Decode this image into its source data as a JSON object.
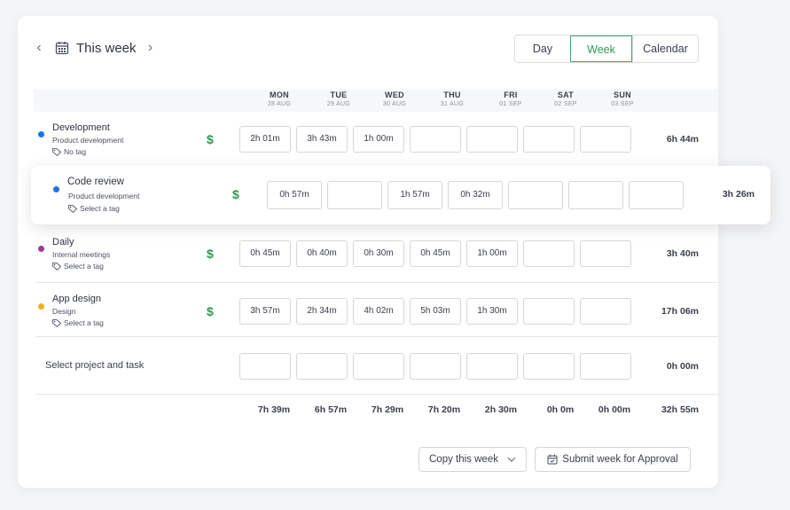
{
  "header": {
    "title": "This week",
    "views": [
      "Day",
      "Week",
      "Calendar"
    ],
    "active_view": "Week"
  },
  "days": [
    {
      "name": "MON",
      "date": "28 AUG"
    },
    {
      "name": "TUE",
      "date": "29 AUG"
    },
    {
      "name": "WED",
      "date": "30 AUG"
    },
    {
      "name": "THU",
      "date": "31 AUG"
    },
    {
      "name": "FRI",
      "date": "01 SEP"
    },
    {
      "name": "SAT",
      "date": "02 SEP"
    },
    {
      "name": "SUN",
      "date": "03 SEP"
    }
  ],
  "rows": [
    {
      "project": "Development",
      "client": "Product development",
      "tag": "No tag",
      "dot_color": "#1a73e8",
      "entries": [
        "2h 01m",
        "3h 43m",
        "1h 00m",
        "",
        "",
        "",
        ""
      ],
      "total": "6h 44m"
    },
    {
      "project": "Code review",
      "client": "Product development",
      "tag": "Select a tag",
      "dot_color": "#1a73e8",
      "entries": [
        "0h 57m",
        "",
        "1h 57m",
        "0h 32m",
        "",
        "",
        ""
      ],
      "total": "3h 26m"
    },
    {
      "project": "Daily",
      "client": "Internal meetings",
      "tag": "Select a tag",
      "dot_color": "#a23b8c",
      "entries": [
        "0h 45m",
        "0h 40m",
        "0h 30m",
        "0h 45m",
        "1h 00m",
        "",
        ""
      ],
      "total": "3h 40m"
    },
    {
      "project": "App design",
      "client": "Design",
      "tag": "Select a tag",
      "dot_color": "#f2b01e",
      "entries": [
        "3h 57m",
        "2h 34m",
        "4h 02m",
        "5h 03m",
        "1h 30m",
        "",
        ""
      ],
      "total": "17h 06m"
    }
  ],
  "new_row": {
    "label": "Select project and task",
    "entries": [
      "",
      "",
      "",
      "",
      "",
      "",
      ""
    ],
    "total": "0h 00m"
  },
  "totals": {
    "days": [
      "7h 39m",
      "6h 57m",
      "7h 29m",
      "7h 20m",
      "2h 30m",
      "0h 0m",
      "0h 00m"
    ],
    "week": "32h 55m"
  },
  "footer": {
    "copy_label": "Copy this week",
    "submit_label": "Submit week for Approval"
  },
  "colors": {
    "accent": "#2d9a52",
    "billable": "#2d9a52"
  }
}
